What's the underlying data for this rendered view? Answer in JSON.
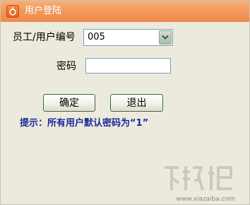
{
  "window": {
    "title": "用户登陆"
  },
  "form": {
    "user_label": "员工/用户编号",
    "user_value": "005",
    "password_label": "密码",
    "password_value": ""
  },
  "buttons": {
    "ok_label": "确定",
    "exit_label": "退出"
  },
  "hint": "提示：所有用户默认密码为“1”",
  "watermark": {
    "text": "下载吧",
    "url_text": "www.xiazaiba.com"
  },
  "colors": {
    "titlebar": "#f39a5e",
    "hint": "#1a2a9a",
    "window_bg": "#eceadd",
    "button_border": "#3f6b3a"
  }
}
